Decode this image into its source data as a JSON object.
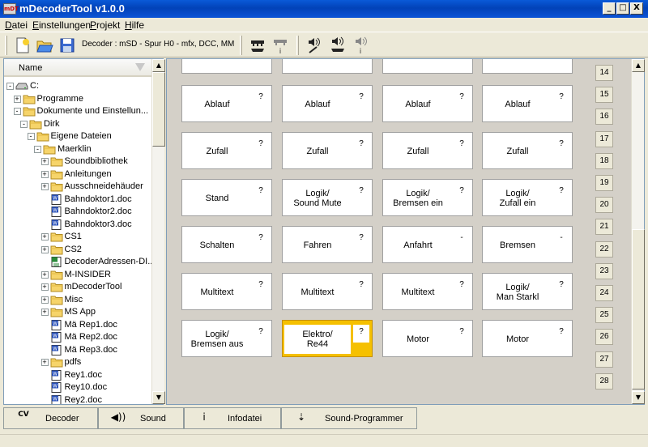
{
  "window": {
    "title": "mDecoderTool v1.0.0",
    "app_icon_text": "mDT"
  },
  "window_controls": {
    "minimize": "_",
    "maximize": "□",
    "close": "X"
  },
  "menu": [
    {
      "label": "Datei",
      "ul": "D"
    },
    {
      "label": "Einstellungen",
      "ul": "E"
    },
    {
      "label": "Projekt",
      "ul": "P"
    },
    {
      "label": "Hilfe",
      "ul": "H"
    }
  ],
  "toolbar": {
    "decoder_label": "Decoder : mSD - Spur H0 - mfx, DCC, MM",
    "icons": [
      "new-file-icon",
      "open-folder-icon",
      "save-icon",
      "read-decoder-icon",
      "decoder-info-icon",
      "sound-write-icon",
      "sound-read-icon",
      "sound-info-icon"
    ]
  },
  "tree": {
    "header": "Name",
    "items": [
      {
        "label": "C:",
        "level": 0,
        "expander": "-",
        "icon": "drive"
      },
      {
        "label": "Programme",
        "level": 1,
        "expander": "+",
        "icon": "folder"
      },
      {
        "label": "Dokumente und Einstellun...",
        "level": 1,
        "expander": "-",
        "icon": "folder"
      },
      {
        "label": "Dirk",
        "level": 2,
        "expander": "-",
        "icon": "folder"
      },
      {
        "label": "Eigene Dateien",
        "level": 3,
        "expander": "-",
        "icon": "folder"
      },
      {
        "label": "Maerklin",
        "level": 4,
        "expander": "-",
        "icon": "folder"
      },
      {
        "label": "Soundbibliothek",
        "level": 5,
        "expander": "+",
        "icon": "folder"
      },
      {
        "label": "Anleitungen",
        "level": 5,
        "expander": "+",
        "icon": "folder"
      },
      {
        "label": "Ausschneidehäuder",
        "level": 5,
        "expander": "+",
        "icon": "folder"
      },
      {
        "label": "Bahndoktor1.doc",
        "level": 5,
        "expander": "",
        "icon": "doc"
      },
      {
        "label": "Bahndoktor2.doc",
        "level": 5,
        "expander": "",
        "icon": "doc"
      },
      {
        "label": "Bahndoktor3.doc",
        "level": 5,
        "expander": "",
        "icon": "doc"
      },
      {
        "label": "CS1",
        "level": 5,
        "expander": "+",
        "icon": "folder"
      },
      {
        "label": "CS2",
        "level": 5,
        "expander": "+",
        "icon": "folder"
      },
      {
        "label": "DecoderAdressen-DI...",
        "level": 5,
        "expander": "",
        "icon": "sheet"
      },
      {
        "label": "M-INSIDER",
        "level": 5,
        "expander": "+",
        "icon": "folder"
      },
      {
        "label": "mDecoderTool",
        "level": 5,
        "expander": "+",
        "icon": "folder"
      },
      {
        "label": "Misc",
        "level": 5,
        "expander": "+",
        "icon": "folder"
      },
      {
        "label": "MS App",
        "level": 5,
        "expander": "+",
        "icon": "folder"
      },
      {
        "label": "Mä Rep1.doc",
        "level": 5,
        "expander": "",
        "icon": "doc"
      },
      {
        "label": "Mä Rep2.doc",
        "level": 5,
        "expander": "",
        "icon": "doc"
      },
      {
        "label": "Mä Rep3.doc",
        "level": 5,
        "expander": "",
        "icon": "doc"
      },
      {
        "label": "pdfs",
        "level": 5,
        "expander": "+",
        "icon": "folder"
      },
      {
        "label": "Rey1.doc",
        "level": 5,
        "expander": "",
        "icon": "doc"
      },
      {
        "label": "Rey10.doc",
        "level": 5,
        "expander": "",
        "icon": "doc"
      },
      {
        "label": "Rey2.doc",
        "level": 5,
        "expander": "",
        "icon": "doc"
      }
    ]
  },
  "grid": {
    "partial_row": [
      "",
      "",
      "",
      ""
    ],
    "rows": [
      [
        {
          "label": "Ablauf",
          "mark": "?"
        },
        {
          "label": "Ablauf",
          "mark": "?"
        },
        {
          "label": "Ablauf",
          "mark": "?"
        },
        {
          "label": "Ablauf",
          "mark": "?"
        }
      ],
      [
        {
          "label": "Zufall",
          "mark": "?"
        },
        {
          "label": "Zufall",
          "mark": "?"
        },
        {
          "label": "Zufall",
          "mark": "?"
        },
        {
          "label": "Zufall",
          "mark": "?"
        }
      ],
      [
        {
          "label": "Stand",
          "mark": "?"
        },
        {
          "label": "Logik/\nSound Mute",
          "mark": "?"
        },
        {
          "label": "Logik/\nBremsen ein",
          "mark": "?"
        },
        {
          "label": "Logik/\nZufall ein",
          "mark": "?"
        }
      ],
      [
        {
          "label": "Schalten",
          "mark": "?"
        },
        {
          "label": "Fahren",
          "mark": "?"
        },
        {
          "label": "Anfahrt",
          "mark": "-"
        },
        {
          "label": "Bremsen",
          "mark": "-"
        }
      ],
      [
        {
          "label": "Multitext",
          "mark": "?"
        },
        {
          "label": "Multitext",
          "mark": "?"
        },
        {
          "label": "Multitext",
          "mark": "?"
        },
        {
          "label": "Logik/\nMan Starkl",
          "mark": "?"
        }
      ],
      [
        {
          "label": "Logik/\nBremsen aus",
          "mark": "?"
        },
        {
          "label": "Elektro/\nRe44",
          "mark": "?",
          "selected": true
        },
        {
          "label": "Motor",
          "mark": "?"
        },
        {
          "label": "Motor",
          "mark": "?"
        }
      ]
    ],
    "numbers": [
      "14",
      "15",
      "16",
      "17",
      "18",
      "19",
      "20",
      "21",
      "22",
      "23",
      "24",
      "25",
      "26",
      "27",
      "28"
    ]
  },
  "tabs": [
    {
      "label": "Decoder",
      "icon_text": "CV",
      "icon": "cv-decoder-icon"
    },
    {
      "label": "Sound",
      "icon_text": "◀))",
      "icon": "speaker-icon",
      "active": true
    },
    {
      "label": "Infodatei",
      "icon_text": "i",
      "icon": "info-icon"
    },
    {
      "label": "Sound-Programmer",
      "icon_text": "⇣",
      "icon": "sound-programmer-icon"
    }
  ]
}
